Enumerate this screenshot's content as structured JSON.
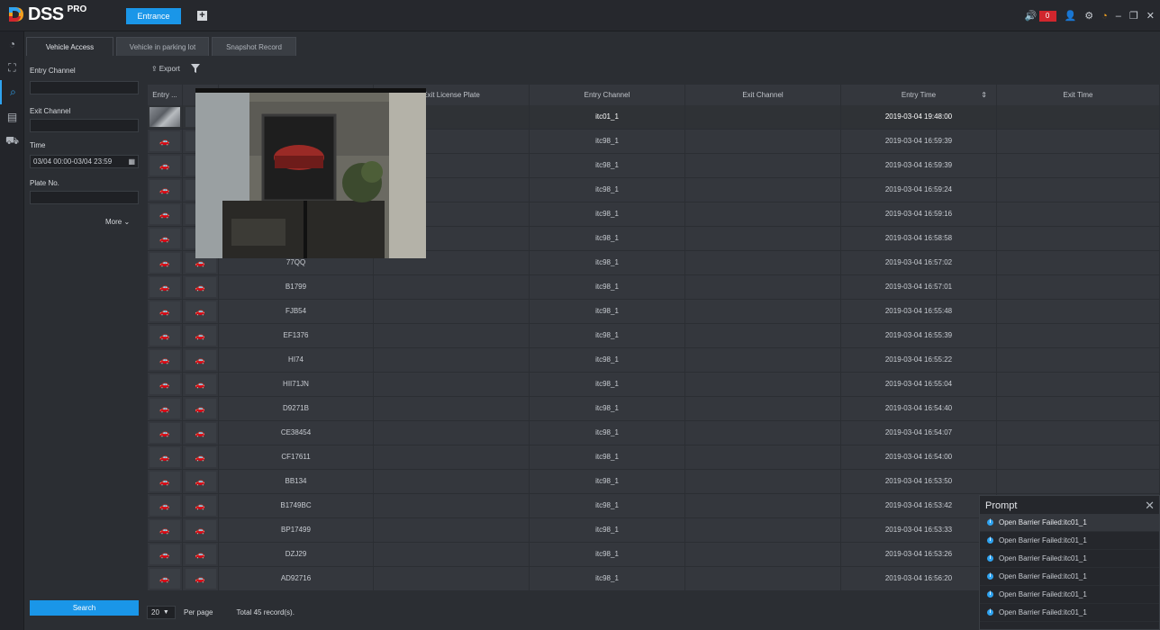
{
  "app": {
    "logo_text": "DSS",
    "logo_pro": "PRO",
    "active_tab": "Entrance",
    "add_tab_icon": "plus-icon",
    "alarm_count": "0",
    "brand_color": "#1a96e8"
  },
  "subtabs": [
    "Vehicle Access",
    "Vehicle in parking lot",
    "Snapshot Record"
  ],
  "filters": {
    "entry_channel_label": "Entry Channel",
    "entry_channel_value": "",
    "exit_channel_label": "Exit Channel",
    "exit_channel_value": "",
    "time_label": "Time",
    "time_value": "03/04 00:00-03/04 23:59",
    "plate_label": "Plate No.",
    "plate_value": "",
    "more_label": "More",
    "search_label": "Search"
  },
  "toolbar": {
    "export_label": "Export"
  },
  "table": {
    "headers": {
      "entry1": "Entry ...",
      "entry2": "E...",
      "plate": "",
      "exit_plate": "Exit License Plate",
      "entry_channel": "Entry Channel",
      "exit_channel": "Exit Channel",
      "entry_time": "Entry Time",
      "exit_time": "Exit Time"
    },
    "rows": [
      {
        "plate": "",
        "exit_plate": "",
        "entry_channel": "itc01_1",
        "exit_channel": "",
        "entry_time": "2019-03-04 19:48:00",
        "exit_time": ""
      },
      {
        "plate": "",
        "exit_plate": "",
        "entry_channel": "itc98_1",
        "exit_channel": "",
        "entry_time": "2019-03-04 16:59:39",
        "exit_time": ""
      },
      {
        "plate": "",
        "exit_plate": "",
        "entry_channel": "itc98_1",
        "exit_channel": "",
        "entry_time": "2019-03-04 16:59:39",
        "exit_time": ""
      },
      {
        "plate": "",
        "exit_plate": "",
        "entry_channel": "itc98_1",
        "exit_channel": "",
        "entry_time": "2019-03-04 16:59:24",
        "exit_time": ""
      },
      {
        "plate": "",
        "exit_plate": "",
        "entry_channel": "itc98_1",
        "exit_channel": "",
        "entry_time": "2019-03-04 16:59:16",
        "exit_time": ""
      },
      {
        "plate": "",
        "exit_plate": "",
        "entry_channel": "itc98_1",
        "exit_channel": "",
        "entry_time": "2019-03-04 16:58:58",
        "exit_time": ""
      },
      {
        "plate": "77QQ",
        "exit_plate": "",
        "entry_channel": "itc98_1",
        "exit_channel": "",
        "entry_time": "2019-03-04 16:57:02",
        "exit_time": ""
      },
      {
        "plate": "B1799",
        "exit_plate": "",
        "entry_channel": "itc98_1",
        "exit_channel": "",
        "entry_time": "2019-03-04 16:57:01",
        "exit_time": ""
      },
      {
        "plate": "FJB54",
        "exit_plate": "",
        "entry_channel": "itc98_1",
        "exit_channel": "",
        "entry_time": "2019-03-04 16:55:48",
        "exit_time": ""
      },
      {
        "plate": "EF1376",
        "exit_plate": "",
        "entry_channel": "itc98_1",
        "exit_channel": "",
        "entry_time": "2019-03-04 16:55:39",
        "exit_time": ""
      },
      {
        "plate": "HI74",
        "exit_plate": "",
        "entry_channel": "itc98_1",
        "exit_channel": "",
        "entry_time": "2019-03-04 16:55:22",
        "exit_time": ""
      },
      {
        "plate": "HII71JN",
        "exit_plate": "",
        "entry_channel": "itc98_1",
        "exit_channel": "",
        "entry_time": "2019-03-04 16:55:04",
        "exit_time": ""
      },
      {
        "plate": "D9271B",
        "exit_plate": "",
        "entry_channel": "itc98_1",
        "exit_channel": "",
        "entry_time": "2019-03-04 16:54:40",
        "exit_time": ""
      },
      {
        "plate": "CE38454",
        "exit_plate": "",
        "entry_channel": "itc98_1",
        "exit_channel": "",
        "entry_time": "2019-03-04 16:54:07",
        "exit_time": ""
      },
      {
        "plate": "CF17611",
        "exit_plate": "",
        "entry_channel": "itc98_1",
        "exit_channel": "",
        "entry_time": "2019-03-04 16:54:00",
        "exit_time": ""
      },
      {
        "plate": "BB134",
        "exit_plate": "",
        "entry_channel": "itc98_1",
        "exit_channel": "",
        "entry_time": "2019-03-04 16:53:50",
        "exit_time": ""
      },
      {
        "plate": "B1749BC",
        "exit_plate": "",
        "entry_channel": "itc98_1",
        "exit_channel": "",
        "entry_time": "2019-03-04 16:53:42",
        "exit_time": ""
      },
      {
        "plate": "BP17499",
        "exit_plate": "",
        "entry_channel": "itc98_1",
        "exit_channel": "",
        "entry_time": "2019-03-04 16:53:33",
        "exit_time": ""
      },
      {
        "plate": "DZJ29",
        "exit_plate": "",
        "entry_channel": "itc98_1",
        "exit_channel": "",
        "entry_time": "2019-03-04 16:53:26",
        "exit_time": ""
      },
      {
        "plate": "AD92716",
        "exit_plate": "",
        "entry_channel": "itc98_1",
        "exit_channel": "",
        "entry_time": "2019-03-04 16:56:20",
        "exit_time": ""
      }
    ]
  },
  "footer": {
    "page_size": "20",
    "per_page_label": "Per page",
    "total_label": "Total 45 record(s)."
  },
  "prompt": {
    "title": "Prompt",
    "items": [
      "Open Barrier Failed:itc01_1",
      "Open Barrier Failed:itc01_1",
      "Open Barrier Failed:itc01_1",
      "Open Barrier Failed:itc01_1",
      "Open Barrier Failed:itc01_1",
      "Open Barrier Failed:itc01_1"
    ]
  }
}
